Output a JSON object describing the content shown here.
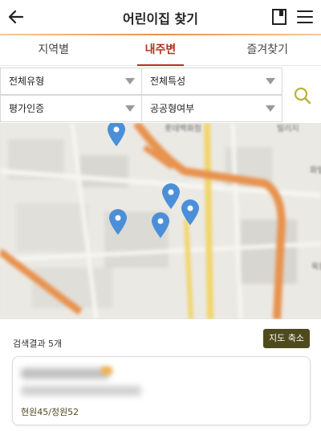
{
  "header": {
    "title": "어린이집 찾기"
  },
  "tabs": [
    {
      "label": "지역별"
    },
    {
      "label": "내주변"
    },
    {
      "label": "즐겨찾기"
    }
  ],
  "filters": {
    "type": "전체유형",
    "feature": "전체특성",
    "accreditation": "평가인증",
    "public": "공공형여부"
  },
  "map": {
    "labels": [
      "롯데백화점",
      "빌리지",
      "화빌",
      "목동"
    ]
  },
  "results": {
    "count_label": "검색결과 5개",
    "shrink_button": "지도 축소",
    "items": [
      {
        "status": "현원45/정원52"
      }
    ]
  },
  "colors": {
    "accent": "#b3321f",
    "olive": "#4d4b1d",
    "pin": "#4a8fd8",
    "road": "#e8924e"
  },
  "icons": [
    "back-arrow-icon",
    "book-icon",
    "menu-icon",
    "search-icon",
    "map-pin-icon",
    "dropdown-arrow-icon"
  ]
}
